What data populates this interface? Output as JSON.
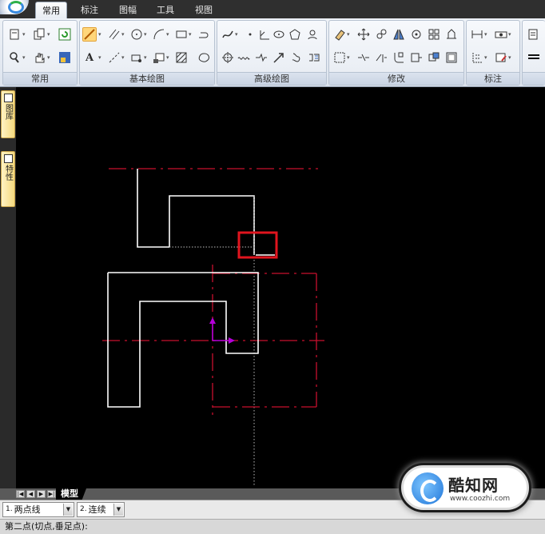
{
  "tabs": [
    {
      "label": "常用",
      "active": true
    },
    {
      "label": "标注",
      "active": false
    },
    {
      "label": "图幅",
      "active": false
    },
    {
      "label": "工具",
      "active": false
    },
    {
      "label": "视图",
      "active": false
    }
  ],
  "ribbon": {
    "groups": [
      {
        "label": "常用"
      },
      {
        "label": "基本绘图"
      },
      {
        "label": "高级绘图"
      },
      {
        "label": "修改"
      },
      {
        "label": "标注"
      }
    ],
    "draw_text_tool": "A"
  },
  "left_palette": {
    "tab1_label": "图库",
    "tab2_label": "特性"
  },
  "model_tab": {
    "label": "模型"
  },
  "command_options": [
    {
      "num": "1.",
      "value": "两点线"
    },
    {
      "num": "2.",
      "value": "连续"
    }
  ],
  "status": {
    "prompt": "第二点(切点,垂足点):"
  },
  "watermark": {
    "name": "酷知网",
    "url": "www.coozhi.com"
  },
  "colors": {
    "canvas": "#000000",
    "geometry": "#ffffff",
    "centerline": "#c8102e",
    "highlight": "#e0141e",
    "axis": "#b400d8"
  }
}
